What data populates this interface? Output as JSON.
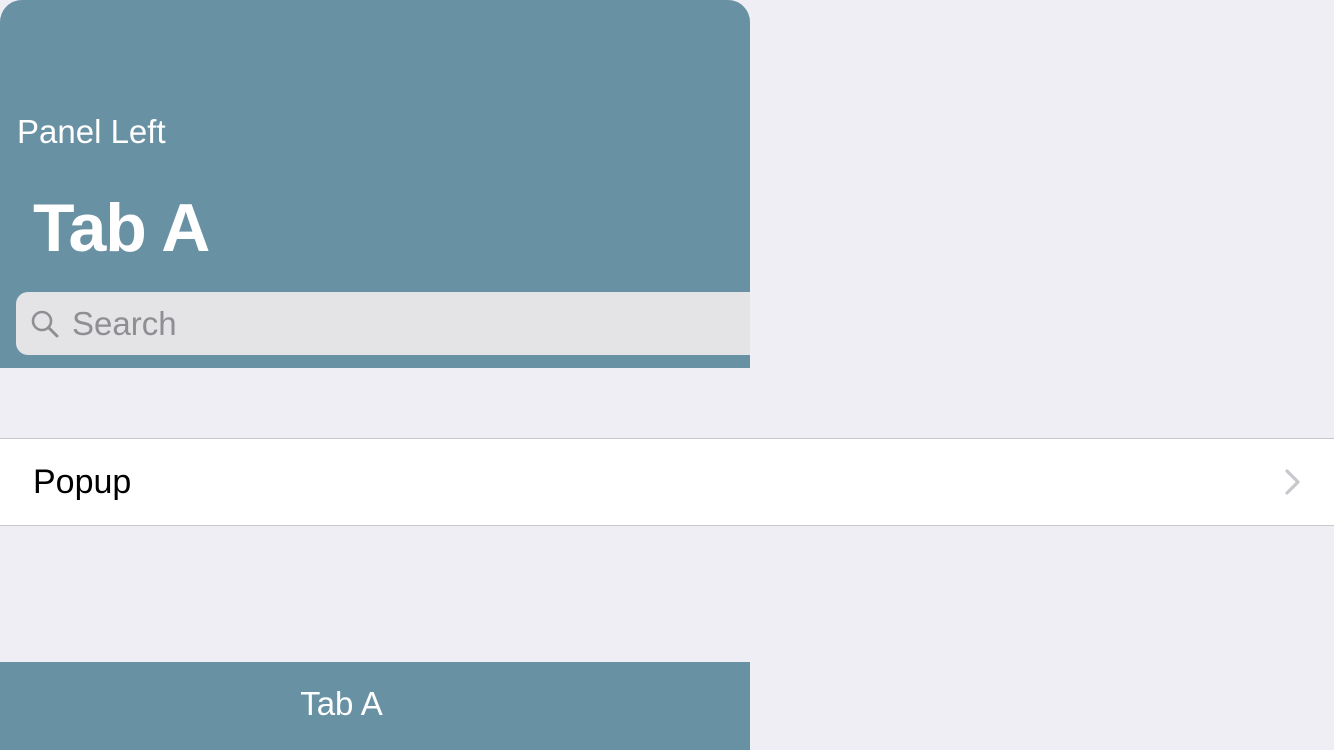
{
  "header": {
    "panel_left_label": "Panel Left",
    "title": "Tab A"
  },
  "search": {
    "placeholder": "Search",
    "value": "",
    "icon": "magnifying-glass"
  },
  "list": {
    "items": [
      {
        "label": "Popup",
        "accessory_icon": "chevron-right"
      }
    ]
  },
  "tab_bar": {
    "tabs": [
      {
        "label": "Tab A",
        "selected": true
      }
    ]
  },
  "colors": {
    "accent": "#6891a4",
    "background": "#efeef4",
    "search_field": "#e4e4e6",
    "separator": "#c8c7cc",
    "chevron": "#c7c7cc",
    "placeholder": "#8e8e93"
  }
}
